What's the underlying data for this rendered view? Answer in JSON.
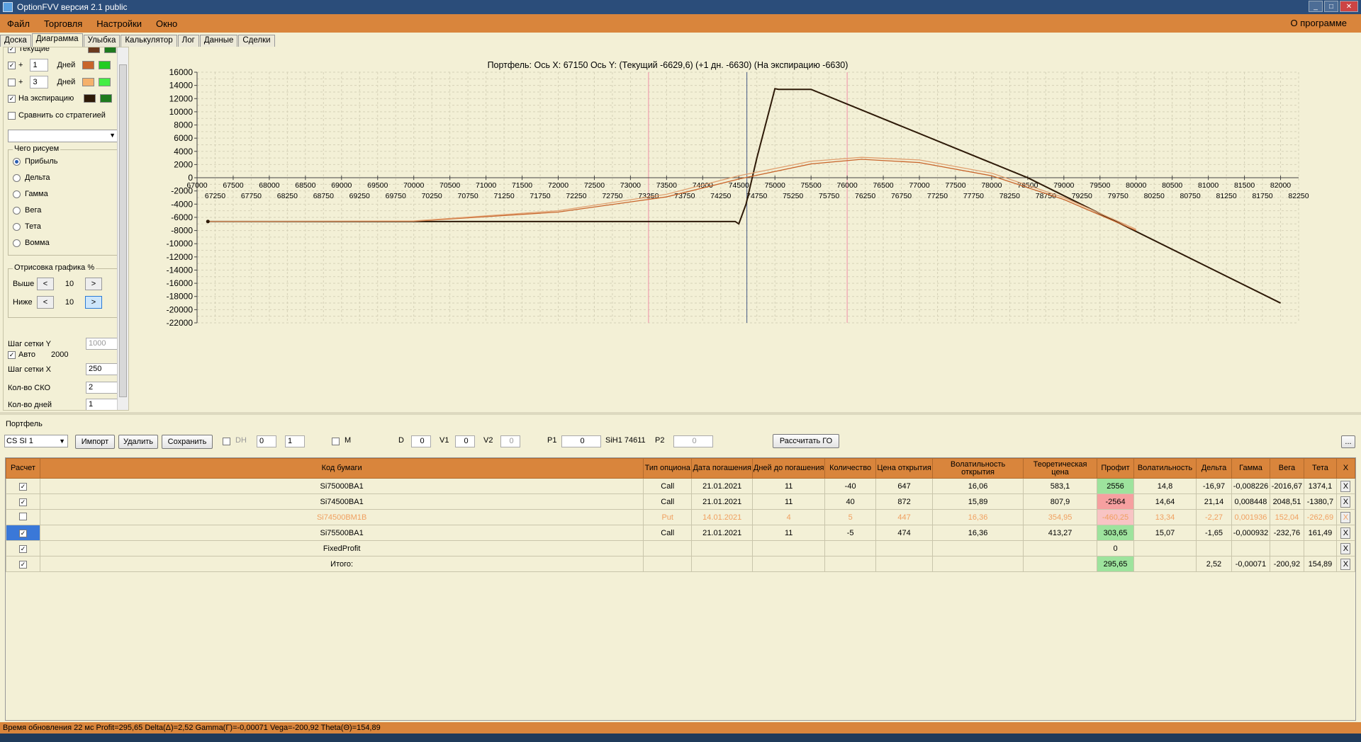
{
  "window": {
    "title": "OptionFVV версия 2.1 public"
  },
  "menu": {
    "items": [
      "Файл",
      "Торговля",
      "Настройки",
      "Окно"
    ],
    "about": "О программе"
  },
  "tabs": [
    "Доска",
    "Диаграмма",
    "Улыбка",
    "Калькулятор",
    "Лог",
    "Данные",
    "Сделки"
  ],
  "left": {
    "current_label": "Текущие",
    "plus1": {
      "sign": "+",
      "value": "1",
      "unit": "Дней"
    },
    "plus3": {
      "sign": "+",
      "value": "3",
      "unit": "Дней"
    },
    "expiry_label": "На экспирацию",
    "compare_label": "Сравнить со стратегией",
    "draw_group": "Чего рисуем",
    "draw_options": [
      "Прибыль",
      "Дельта",
      "Гамма",
      "Вега",
      "Тета",
      "Вомма"
    ],
    "render_group": "Отрисовка графика %",
    "above_label": "Выше",
    "above_value": "10",
    "below_label": "Ниже",
    "below_value": "10",
    "prev": "<",
    "next": ">",
    "gridy_label": "Шаг сетки Y",
    "gridy_value": "1000",
    "auto_label": "Авто",
    "auto_value": "2000",
    "gridx_label": "Шаг сетки X",
    "gridx_value": "250",
    "sko_label": "Кол-во СКО",
    "sko_value": "2",
    "days_label": "Кол-во дней",
    "days_value": "1",
    "colors": {
      "current": [
        "#6b3a1e",
        "#1e7a1e"
      ],
      "plus1": [
        "#c8642a",
        "#22cc22"
      ],
      "plus3": [
        "#f5b06b",
        "#44ee44"
      ],
      "expiry": [
        "#2e1a08",
        "#1e7a1e"
      ]
    }
  },
  "chart_data": {
    "type": "line",
    "title": "Портфель: Ось X: 67150 Ось Y:  (Текущий -6629,6)  (+1 дн. -6630)  (На экспирацию -6630)",
    "ylim": [
      -22000,
      16000
    ],
    "xlim": [
      67000,
      82250
    ],
    "yticks": [
      16000,
      14000,
      12000,
      10000,
      8000,
      6000,
      4000,
      2000,
      0,
      -2000,
      -4000,
      -6000,
      -8000,
      -10000,
      -12000,
      -14000,
      -16000,
      -18000,
      -20000,
      -22000
    ],
    "xticks_top": [
      67000,
      67500,
      68000,
      68500,
      69000,
      69500,
      70000,
      70500,
      71000,
      71500,
      72000,
      72500,
      73000,
      73500,
      74000,
      74500,
      75000,
      75500,
      76000,
      76500,
      77000,
      77500,
      78000,
      78500,
      79000,
      79500,
      80000,
      80500,
      81000,
      81500,
      82000
    ],
    "xticks_bottom": [
      67250,
      67750,
      68250,
      68750,
      69250,
      69750,
      70250,
      70750,
      71250,
      71750,
      72250,
      72750,
      73250,
      73750,
      74250,
      74750,
      75250,
      75750,
      76250,
      76750,
      77250,
      77750,
      78250,
      78750,
      79250,
      79750,
      80250,
      80750,
      81250,
      81750,
      82250
    ],
    "vlines": [
      {
        "x": 73250,
        "color": "#f0a0b0"
      },
      {
        "x": 74611,
        "color": "#607090"
      },
      {
        "x": 76000,
        "color": "#f0a0b0"
      }
    ],
    "series": [
      {
        "color": "#2e1a08",
        "x": [
          67150,
          74450,
          74500,
          74600,
          74750,
          75000,
          75050,
          75500,
          78500,
          82000
        ],
        "y": [
          -6630,
          -6630,
          -7000,
          -4000,
          3000,
          13500,
          13400,
          13400,
          0,
          -19000
        ]
      },
      {
        "color": "#c8642a",
        "x": [
          67150,
          70000,
          72000,
          73500,
          74500,
          75500,
          76200,
          77000,
          78000,
          79000,
          80000
        ],
        "y": [
          -6630,
          -6600,
          -5200,
          -2900,
          -200,
          2100,
          2800,
          2300,
          300,
          -3300,
          -8000
        ]
      },
      {
        "color": "#e0a070",
        "x": [
          67150,
          70000,
          72000,
          73500,
          74500,
          75500,
          76200,
          77000,
          78000,
          79000,
          80000
        ],
        "y": [
          -6630,
          -6550,
          -5000,
          -2500,
          300,
          2500,
          3100,
          2700,
          700,
          -3000,
          -7800
        ]
      }
    ]
  },
  "portfolio": {
    "label": "Портфель",
    "name": "CS SI 1",
    "import": "Импорт",
    "delete": "Удалить",
    "save": "Сохранить",
    "dh": "DH",
    "dh_a": "0",
    "dh_b": "1",
    "m": "M",
    "d_label": "D",
    "d_value": "0",
    "v1_label": "V1",
    "v1_value": "0",
    "v2_label": "V2",
    "v2_value": "0",
    "p1_label": "P1",
    "p1_value": "0",
    "sih": "SiH1 74611",
    "p2_label": "P2",
    "p2_value": "0",
    "go_button": "Рассчитать ГО",
    "dots": "..."
  },
  "table": {
    "headers": [
      "Расчет",
      "Код бумаги",
      "Тип опциона",
      "Дата погашения",
      "Дней до погашения",
      "Количество",
      "Цена открытия",
      "Волатильность открытия",
      "Теоретическая цена",
      "Профит",
      "Волатильность",
      "Дельта",
      "Гамма",
      "Вега",
      "Тета",
      "X"
    ],
    "rows": [
      {
        "code": "Si75000BA1",
        "type": "Call",
        "date": "21.01.2021",
        "days": "11",
        "qty": "-40",
        "open": "647",
        "volo": "16,06",
        "theo": "583,1",
        "profit": "2556",
        "vol": "14,8",
        "delta": "-16,97",
        "gamma": "-0,008226",
        "vega": "-2016,67",
        "theta": "1374,1",
        "cls": "pos"
      },
      {
        "code": "Si74500BA1",
        "type": "Call",
        "date": "21.01.2021",
        "days": "11",
        "qty": "40",
        "open": "872",
        "volo": "15,89",
        "theo": "807,9",
        "profit": "-2564",
        "vol": "14,64",
        "delta": "21,14",
        "gamma": "0,008448",
        "vega": "2048,51",
        "theta": "-1380,7",
        "cls": "neg"
      },
      {
        "code": "Si74500BM1B",
        "type": "Put",
        "date": "14.01.2021",
        "days": "4",
        "qty": "5",
        "open": "447",
        "volo": "16,36",
        "theo": "354,95",
        "profit": "-460,25",
        "vol": "13,34",
        "delta": "-2,27",
        "gamma": "0,001936",
        "vega": "152,04",
        "theta": "-262,69",
        "cls": "negl"
      },
      {
        "code": "Si75500BA1",
        "type": "Call",
        "date": "21.01.2021",
        "days": "11",
        "qty": "-5",
        "open": "474",
        "volo": "16,36",
        "theo": "413,27",
        "profit": "303,65",
        "vol": "15,07",
        "delta": "-1,65",
        "gamma": "-0,000932",
        "vega": "-232,76",
        "theta": "161,49",
        "cls": "pos"
      },
      {
        "code": "FixedProfit",
        "type": "",
        "date": "",
        "days": "",
        "qty": "",
        "open": "",
        "volo": "",
        "theo": "",
        "profit": "0",
        "vol": "",
        "delta": "",
        "gamma": "",
        "vega": "",
        "theta": "",
        "cls": ""
      },
      {
        "code": "Итого:",
        "type": "",
        "date": "",
        "days": "",
        "qty": "",
        "open": "",
        "volo": "",
        "theo": "",
        "profit": "295,65",
        "vol": "",
        "delta": "2,52",
        "gamma": "-0,00071",
        "vega": "-200,92",
        "theta": "154,89",
        "cls": "pos"
      }
    ],
    "x": "X"
  },
  "status": "Время обновления 22 мс  Profit=295,65 Delta(Δ)=2,52 Gamma(Γ)=-0,00071 Vega=-200,92 Theta(Θ)=154,89"
}
